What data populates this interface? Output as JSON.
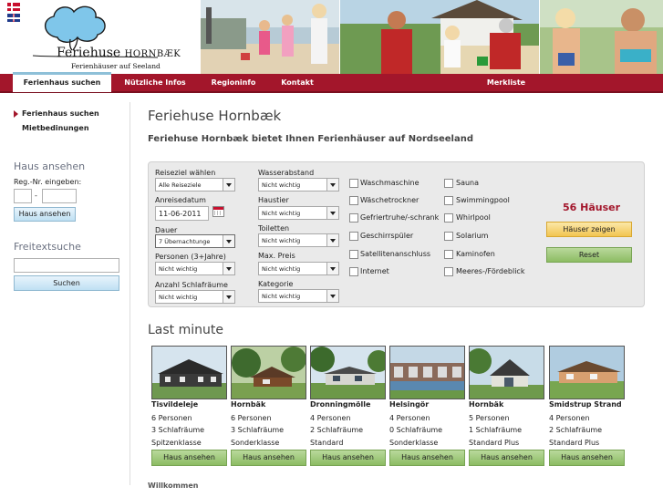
{
  "brand": {
    "name_main": "Feriehuse ",
    "name_sc": "Hornbæk",
    "subtitle": "Ferienhäuser auf Seeland"
  },
  "nav": {
    "items": [
      "Ferienhaus suchen",
      "Nützliche Infos",
      "Regioninfo",
      "Kontakt",
      "Merkliste"
    ]
  },
  "sidebar": {
    "links": [
      "Ferienhaus suchen",
      "Mietbedinungen"
    ],
    "house_view": {
      "title": "Haus ansehen",
      "reg_label": "Reg.-Nr. eingeben:",
      "dash": "-",
      "button": "Haus ansehen"
    },
    "freetext": {
      "title": "Freitextsuche",
      "button": "Suchen"
    }
  },
  "main": {
    "title": "Feriehuse Hornbæk",
    "subtitle": "Feriehuse Hornbæk bietet Ihnen Ferienhäuser auf Nordseeland"
  },
  "search": {
    "col1": [
      {
        "label": "Reiseziel wählen",
        "value": "Alle Reiseziele"
      },
      {
        "label": "Anreisedatum",
        "value": "11-06-2011"
      },
      {
        "label": "Dauer",
        "value": "7 Übernachtunge"
      },
      {
        "label": "Personen (3+Jahre)",
        "value": "Nicht wichtig"
      },
      {
        "label": "Anzahl Schlafräume",
        "value": "Nicht wichtig"
      }
    ],
    "col2": [
      {
        "label": "Wasserabstand",
        "value": "Nicht wichtig"
      },
      {
        "label": "Haustier",
        "value": "Nicht wichtig"
      },
      {
        "label": "Toiletten",
        "value": "Nicht wichtig"
      },
      {
        "label": "Max. Preis",
        "value": "Nicht wichtig"
      },
      {
        "label": "Kategorie",
        "value": "Nicht wichtig"
      }
    ],
    "checks1": [
      "Waschmaschine",
      "Wäschetrockner",
      "Gefriertruhe/-schrank",
      "Geschirrspüler",
      "Satellitenanschluss",
      "Internet"
    ],
    "checks2": [
      "Sauna",
      "Swimmingpool",
      "Whirlpool",
      "Solarium",
      "Kaminofen",
      "Meeres-/Fördeblick"
    ],
    "count": "56 Häuser",
    "show_button": "Häuser zeigen",
    "reset_button": "Reset"
  },
  "last_minute": {
    "title": "Last minute",
    "cards": [
      {
        "name": "Tisvildeleje",
        "persons": "6 Personen",
        "rooms": "3 Schlafräume",
        "class": "Spitzenklasse",
        "button": "Haus ansehen"
      },
      {
        "name": "Hornbäk",
        "persons": "6 Personen",
        "rooms": "3 Schlafräume",
        "class": "Sonderklasse",
        "button": "Haus ansehen"
      },
      {
        "name": "Dronningmölle",
        "persons": "4 Personen",
        "rooms": "2 Schlafräume",
        "class": "Standard",
        "button": "Haus ansehen"
      },
      {
        "name": "Helsingör",
        "persons": "4 Personen",
        "rooms": "0 Schlafräume",
        "class": "Sonderklasse",
        "button": "Haus ansehen"
      },
      {
        "name": "Hornbäk",
        "persons": "5 Personen",
        "rooms": "1 Schlafräume",
        "class": "Standard Plus",
        "button": "Haus ansehen"
      },
      {
        "name": "Smidstrup Strand",
        "persons": "4 Personen",
        "rooms": "2 Schlafräume",
        "class": "Standard Plus",
        "button": "Haus ansehen"
      }
    ]
  },
  "footer": {
    "welcome": "Willkommen"
  },
  "colors": {
    "nav_red": "#a3162b",
    "accent_blue": "#8ec0d8",
    "button_green": "#8cbc63",
    "button_yellow": "#f2c551"
  }
}
